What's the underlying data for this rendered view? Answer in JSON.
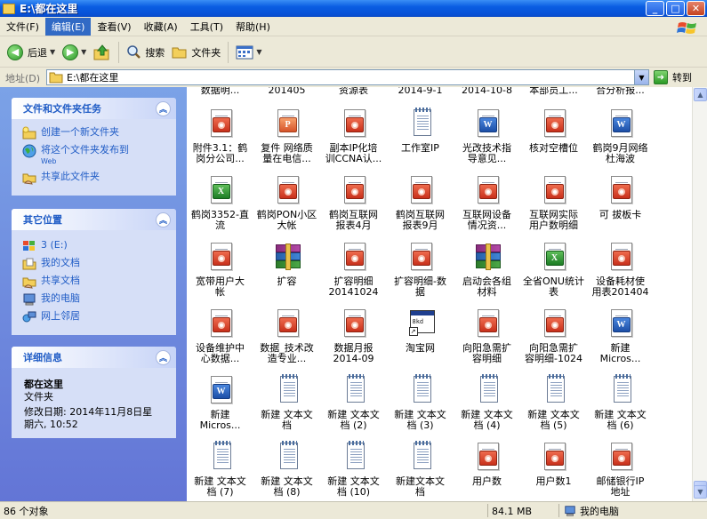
{
  "window": {
    "title": "E:\\都在这里",
    "minimize_glyph": "_",
    "maximize_glyph": "□",
    "close_glyph": "✕"
  },
  "menu": [
    {
      "label": "文件(F)",
      "active": false
    },
    {
      "label": "编辑(E)",
      "active": true
    },
    {
      "label": "查看(V)",
      "active": false
    },
    {
      "label": "收藏(A)",
      "active": false
    },
    {
      "label": "工具(T)",
      "active": false
    },
    {
      "label": "帮助(H)",
      "active": false
    }
  ],
  "toolbar": {
    "back_label": "后退",
    "search_label": "搜索",
    "folders_label": "文件夹"
  },
  "address": {
    "label": "地址(D)",
    "value": "E:\\都在这里",
    "go_label": "转到"
  },
  "tasks_panel": {
    "title": "文件和文件夹任务",
    "items": [
      {
        "label": "创建一个新文件夹",
        "sub": ""
      },
      {
        "label": "将这个文件夹发布到",
        "sub": "Web"
      },
      {
        "label": "共享此文件夹",
        "sub": ""
      }
    ]
  },
  "places_panel": {
    "title": "其它位置",
    "items": [
      "3 (E:)",
      "我的文档",
      "共享文档",
      "我的电脑",
      "网上邻居"
    ]
  },
  "details_panel": {
    "title": "详细信息",
    "name": "都在这里",
    "type": "文件夹",
    "modified_line1": "修改日期: 2014年11月8日星",
    "modified_line2": "期六, 10:52"
  },
  "files": {
    "partial_row": [
      "数据明...",
      "201405",
      "资源表",
      "2014-9-1",
      "2014-10-8",
      "本部员工...",
      "合分析报..."
    ],
    "rows": [
      [
        {
          "label": "附件3.1：鹤\n岗分公司...",
          "type": "pdf"
        },
        {
          "label": "复件 网络质\n量在电信...",
          "type": "ppt"
        },
        {
          "label": "副本IP化培\n训CCNA认...",
          "type": "pdf"
        },
        {
          "label": "工作室IP",
          "type": "txt"
        },
        {
          "label": "光改技术指\n导意见...",
          "type": "word"
        },
        {
          "label": "核对空槽位",
          "type": "pdf"
        },
        {
          "label": "鹤岗9月网络\n杜海波",
          "type": "word"
        }
      ],
      [
        {
          "label": "鹤岗3352-直\n流",
          "type": "excel"
        },
        {
          "label": "鹤岗PON小区\n大帐",
          "type": "pdf"
        },
        {
          "label": "鹤岗互联网\n报表4月",
          "type": "pdf"
        },
        {
          "label": "鹤岗互联网\n报表9月",
          "type": "pdf"
        },
        {
          "label": "互联网设备\n情况资...",
          "type": "pdf"
        },
        {
          "label": "互联网实际\n用户数明细",
          "type": "pdf"
        },
        {
          "label": "可 拔板卡",
          "type": "pdf"
        }
      ],
      [
        {
          "label": "宽带用户大\n帐",
          "type": "pdf"
        },
        {
          "label": "扩容",
          "type": "rar"
        },
        {
          "label": "扩容明细\n20141024",
          "type": "pdf"
        },
        {
          "label": "扩容明细-数\n据",
          "type": "pdf"
        },
        {
          "label": "启动会各组\n材料",
          "type": "rar"
        },
        {
          "label": "全省ONU统计\n表",
          "type": "excel"
        },
        {
          "label": "设备耗材使\n用表201404",
          "type": "pdf"
        }
      ],
      [
        {
          "label": "设备维护中\n心数据...",
          "type": "pdf"
        },
        {
          "label": "数据_技术改\n造专业...",
          "type": "pdf"
        },
        {
          "label": "数据月报\n2014-09",
          "type": "pdf"
        },
        {
          "label": "淘宝网",
          "type": "shortcut"
        },
        {
          "label": "向阳急需扩\n容明细",
          "type": "pdf"
        },
        {
          "label": "向阳急需扩\n容明细-1024",
          "type": "pdf"
        },
        {
          "label": "新建\nMicros...",
          "type": "word"
        }
      ],
      [
        {
          "label": "新建\nMicros...",
          "type": "word"
        },
        {
          "label": "新建 文本文\n档",
          "type": "txt"
        },
        {
          "label": "新建 文本文\n档 (2)",
          "type": "txt"
        },
        {
          "label": "新建 文本文\n档 (3)",
          "type": "txt"
        },
        {
          "label": "新建 文本文\n档 (4)",
          "type": "txt"
        },
        {
          "label": "新建 文本文\n档 (5)",
          "type": "txt"
        },
        {
          "label": "新建 文本文\n档 (6)",
          "type": "txt"
        }
      ],
      [
        {
          "label": "新建 文本文\n档 (7)",
          "type": "txt"
        },
        {
          "label": "新建 文本文\n档 (8)",
          "type": "txt"
        },
        {
          "label": "新建 文本文\n档 (10)",
          "type": "txt"
        },
        {
          "label": "新建文本文\n档",
          "type": "txt"
        },
        {
          "label": "用户数",
          "type": "pdf"
        },
        {
          "label": "用户数1",
          "type": "pdf"
        },
        {
          "label": "邮储银行IP\n地址",
          "type": "pdf"
        }
      ]
    ]
  },
  "status": {
    "objects": "86 个对象",
    "size": "84.1 MB",
    "location": "我的电脑"
  },
  "colors": {
    "titlebar": "#0a5de2",
    "sidebar": "#6375d6",
    "panel_title": "#215dc6",
    "selection": "#316ac5"
  }
}
